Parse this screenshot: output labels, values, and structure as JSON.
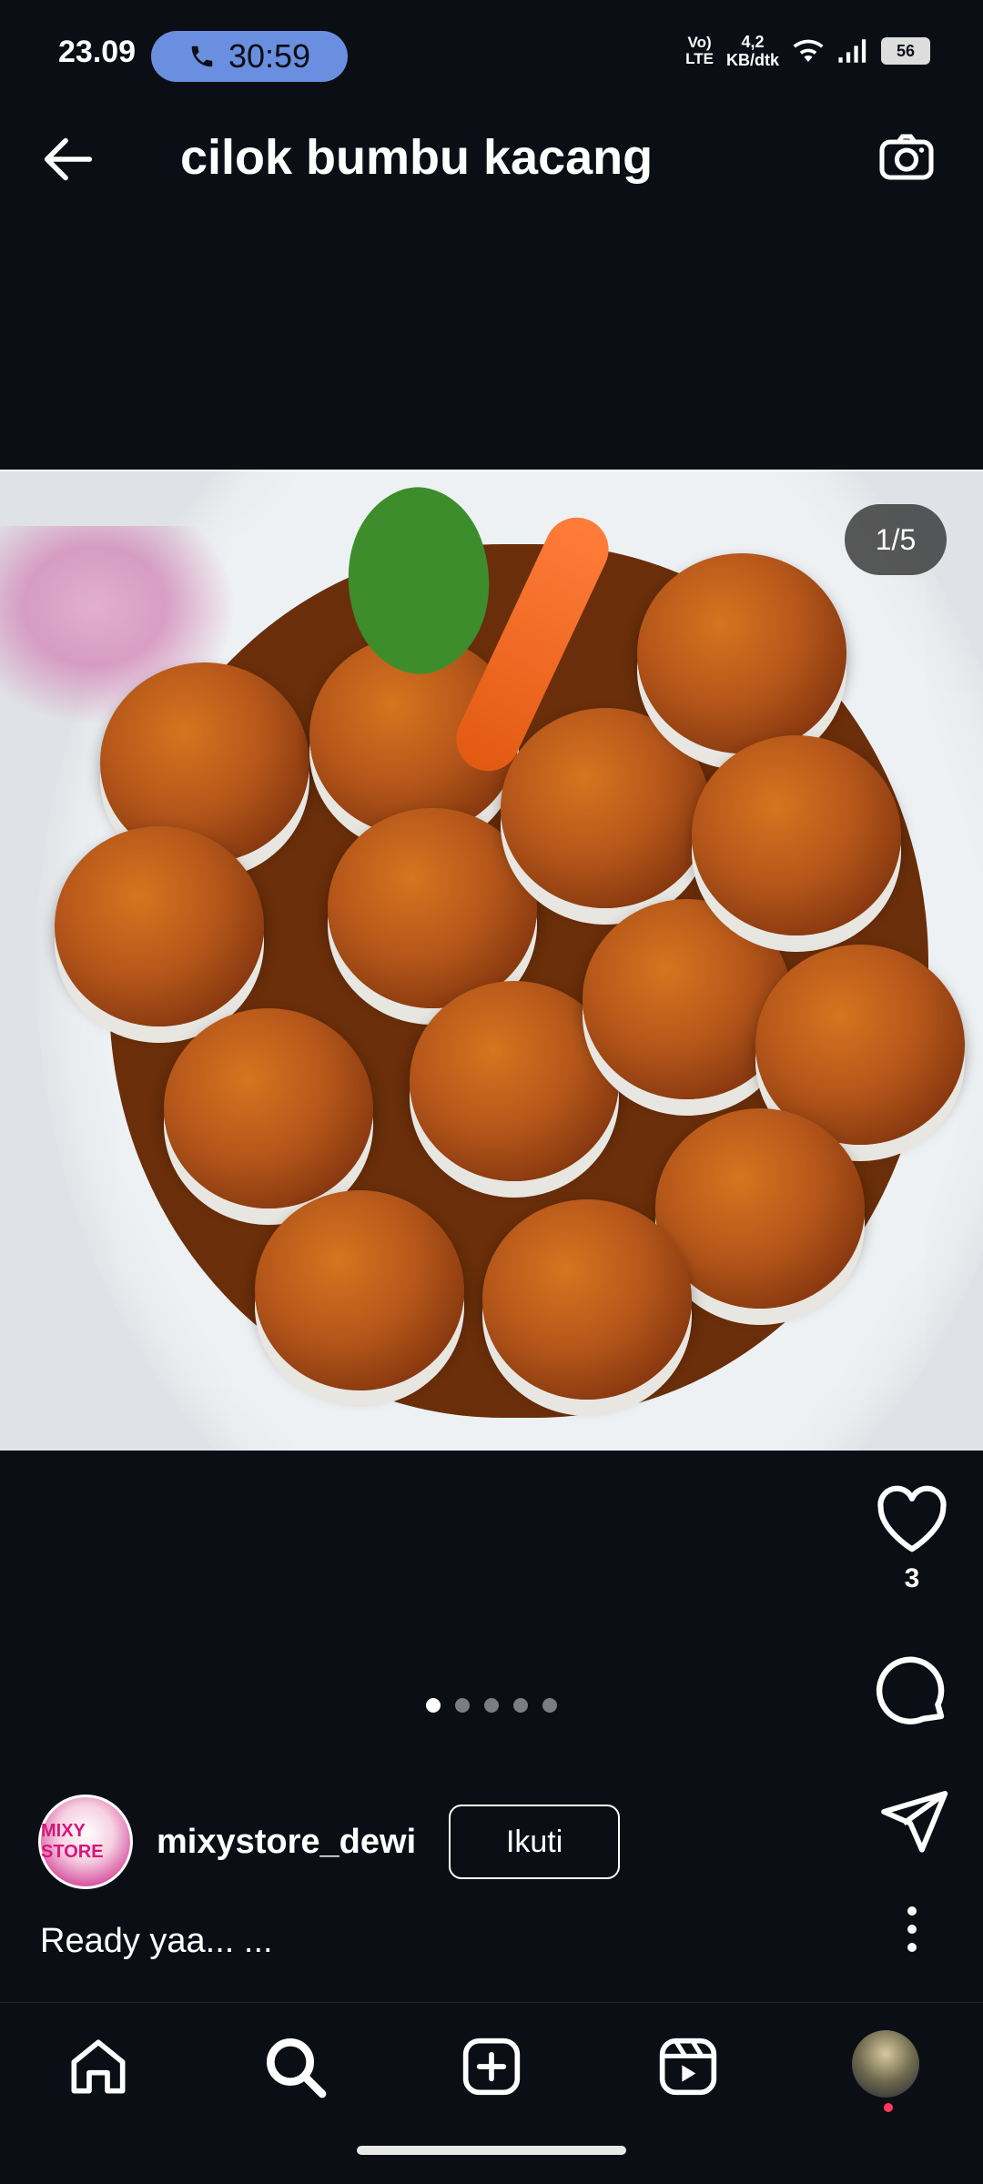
{
  "status_bar": {
    "time": "23.09",
    "call_timer": "30:59",
    "net_type_top": "Vo)",
    "net_type_bottom": "LTE",
    "speed_top": "4,2",
    "speed_bottom": "KB/dtk",
    "battery": "56"
  },
  "header": {
    "title": "cilok bumbu kacang"
  },
  "post": {
    "image_counter": "1/5",
    "like_count": "3",
    "author": "mixystore_dewi",
    "avatar_text": "MIXY STORE",
    "follow_label": "Ikuti",
    "caption": "Ready yaa... ..."
  },
  "pager": {
    "total": 5,
    "active_index": 0
  },
  "icons": {
    "back": "arrow-left-icon",
    "camera": "camera-icon",
    "like": "heart-icon",
    "comment": "comment-icon",
    "share": "send-icon",
    "more": "more-vertical-icon",
    "nav": [
      "home-icon",
      "search-icon",
      "create-icon",
      "reels-icon",
      "profile-avatar"
    ]
  },
  "colors": {
    "background": "#0b0e14",
    "call_pill": "#6b8fe0",
    "notification_dot": "#ff3b5c"
  }
}
